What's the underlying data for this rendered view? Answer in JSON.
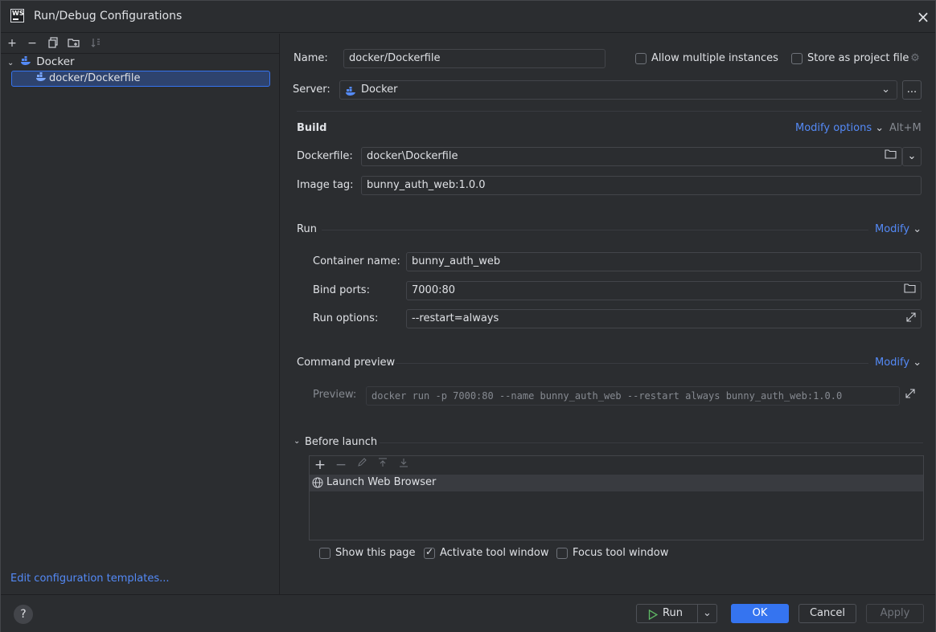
{
  "window": {
    "title": "Run/Debug Configurations",
    "logo_text": "WS"
  },
  "left": {
    "tree": {
      "group": "Docker",
      "item": "docker/Dockerfile"
    },
    "edit_templates": "Edit configuration templates..."
  },
  "form": {
    "name_label": "Name:",
    "name_value": "docker/Dockerfile",
    "allow_multiple": "Allow multiple instances",
    "store_project": "Store as project file",
    "server_label": "Server:",
    "server_value": "Docker",
    "server_more": "...",
    "build": {
      "title": "Build",
      "modify_options": "Modify options",
      "shortcut": "Alt+M",
      "dockerfile_label": "Dockerfile:",
      "dockerfile_value": "docker\\Dockerfile",
      "image_tag_label": "Image tag:",
      "image_tag_value": "bunny_auth_web:1.0.0"
    },
    "run": {
      "title": "Run",
      "modify": "Modify",
      "container_label": "Container name:",
      "container_value": "bunny_auth_web",
      "ports_label": "Bind ports:",
      "ports_value": "7000:80",
      "options_label": "Run options:",
      "options_value": "--restart=always"
    },
    "preview": {
      "title": "Command preview",
      "modify": "Modify",
      "label": "Preview:",
      "value": "docker run -p 7000:80 --name bunny_auth_web --restart always bunny_auth_web:1.0.0"
    },
    "before_launch": {
      "title": "Before launch",
      "task": "Launch Web Browser",
      "show_page": "Show this page",
      "activate_tool": "Activate tool window",
      "focus_tool": "Focus tool window"
    }
  },
  "buttons": {
    "help": "?",
    "run": "Run",
    "ok": "OK",
    "cancel": "Cancel",
    "apply": "Apply"
  }
}
